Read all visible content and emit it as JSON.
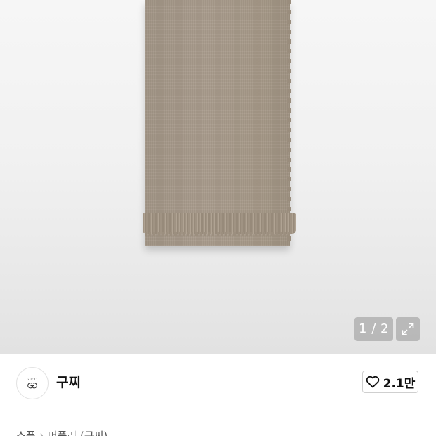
{
  "product_image": {
    "pager_text": "1 / 2"
  },
  "icons": {
    "fullscreen": "expand-icon",
    "like": "heart-outline-icon"
  },
  "brand": {
    "logo_text": "GUCCI",
    "name": "구찌",
    "likes": "2.1만"
  },
  "breadcrumb": {
    "items": [
      "소품",
      "머플러 (구찌)"
    ],
    "separator": "›"
  }
}
